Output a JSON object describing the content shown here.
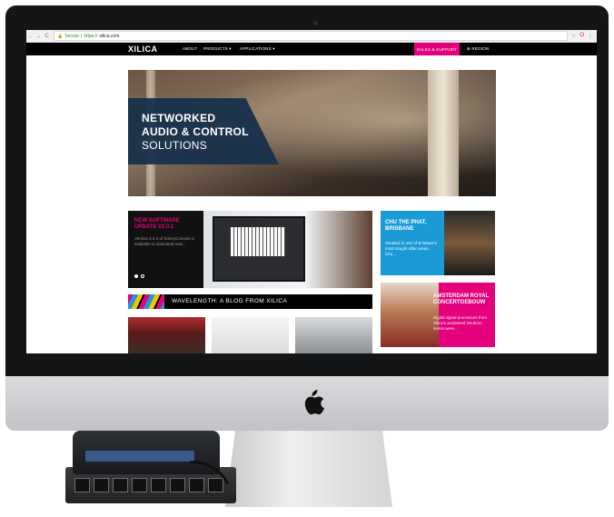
{
  "browser": {
    "nav_back": "←",
    "nav_forward": "→",
    "nav_reload": "C",
    "secure_label": "Secure",
    "url_scheme": "https://",
    "url_host": "xilica.com"
  },
  "site": {
    "logo": "XILICA",
    "nav": {
      "about": "ABOUT",
      "products": "PRODUCTS ▾",
      "applications": "APPLICATIONS ▾",
      "sales_support": "SALES & SUPPORT",
      "region": "⊕ REGION"
    },
    "hero": {
      "line1": "NETWORKED",
      "line2": "AUDIO & CONTROL",
      "line3": "SOLUTIONS"
    },
    "news": {
      "title": "NEW SOFTWARE UPDATE V2.0.1",
      "text": "Version 2.0.1 of SoloryConsole is available to download now..."
    },
    "cards": [
      {
        "title": "CHU THE PHAT, BRISBANE",
        "text": "Situated in one of Brisbane's most sought-after areas, Chu..."
      },
      {
        "title": "AMSTERDAM ROYAL CONCERTGEBOUW",
        "text": "Digital signal processors from Xilica's acclaimed Neutrino series were..."
      }
    ],
    "blog": {
      "title": "WAVELENGTH: A BLOG FROM XILICA"
    }
  },
  "colors": {
    "accent_pink": "#e5007d",
    "accent_blue": "#1a9bd7",
    "hero_panel": "#152f4a"
  },
  "icons": [
    "back-icon",
    "forward-icon",
    "reload-icon",
    "lock-icon",
    "star-icon",
    "opera-icon",
    "menu-icon",
    "apple-logo-icon"
  ]
}
